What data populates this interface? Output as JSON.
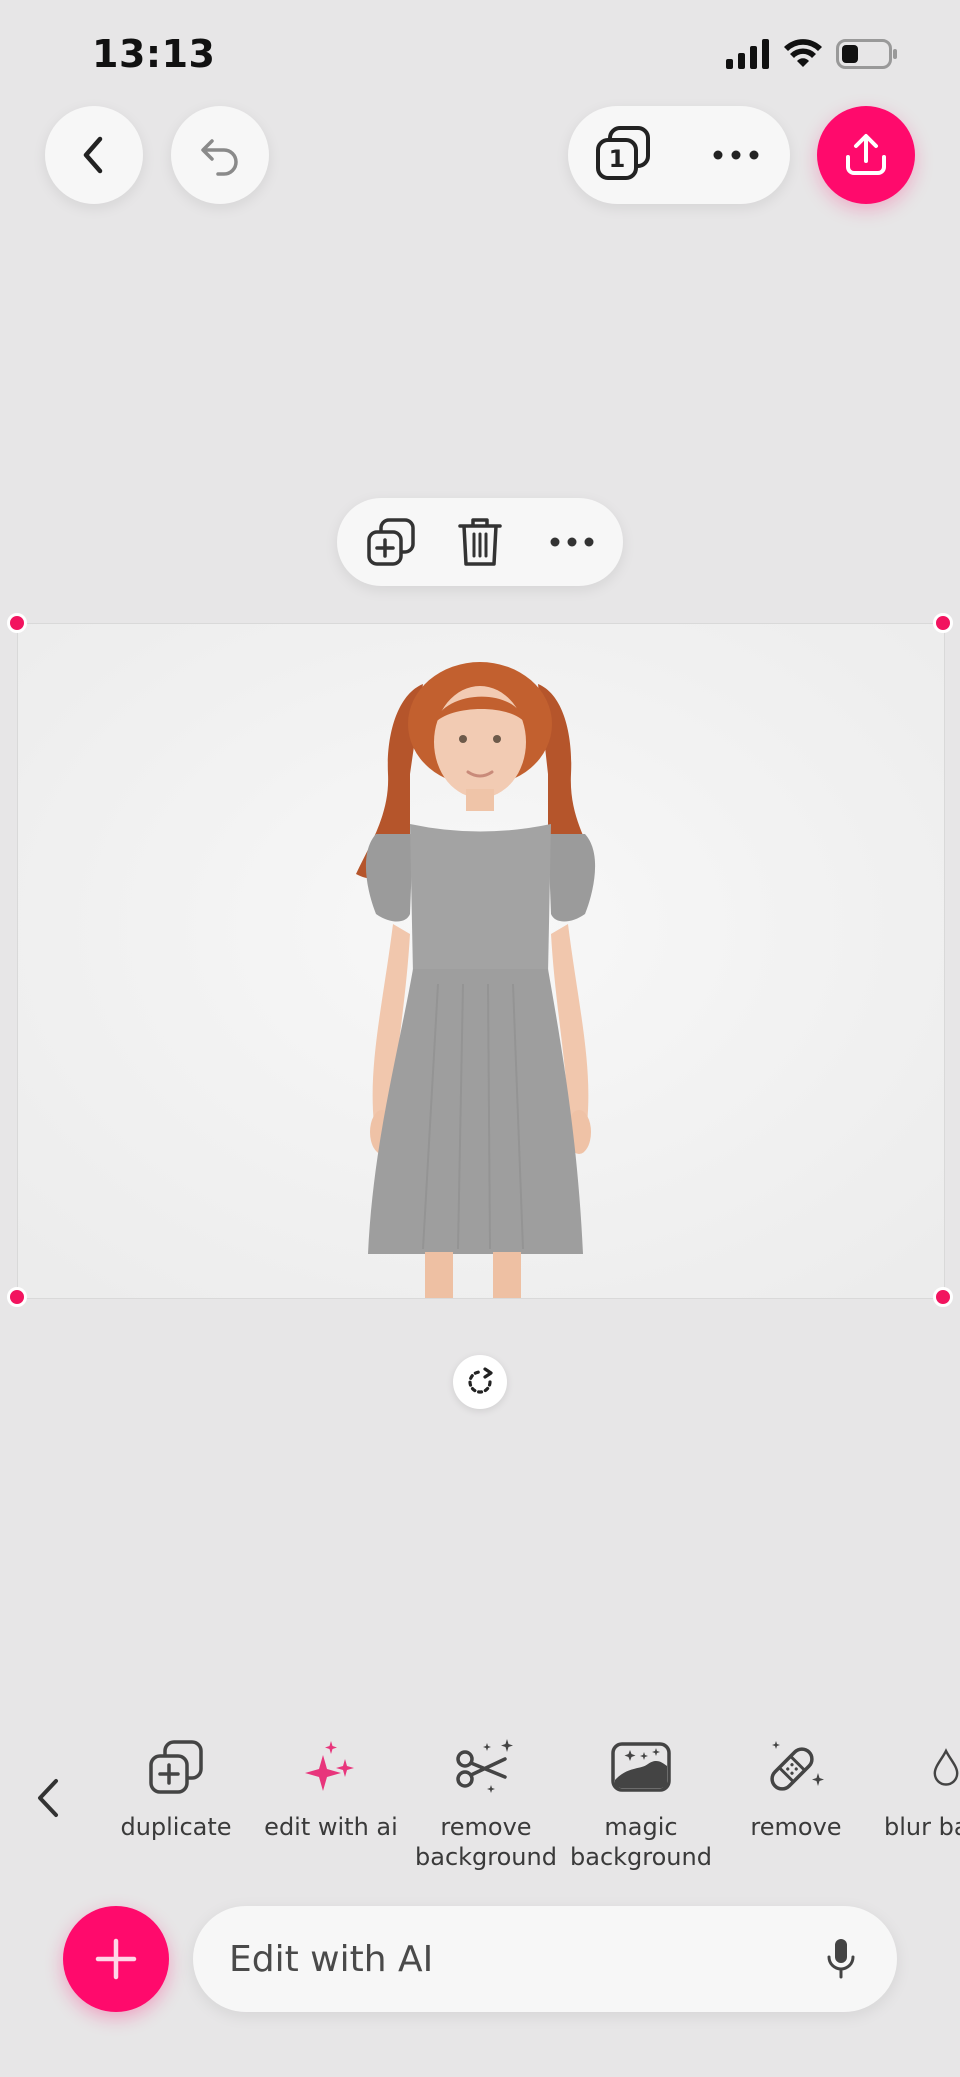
{
  "status_bar": {
    "time": "13:13",
    "icons": [
      "signal-icon",
      "wifi-icon",
      "battery-icon"
    ]
  },
  "top_bar": {
    "back_icon": "chevron-left-icon",
    "undo_icon": "undo-icon",
    "pages_count": "1",
    "more_icon": "ellipsis-icon",
    "share_icon": "share-upload-icon",
    "accent_color": "#ff0a6c"
  },
  "selection_menu": {
    "icons": [
      "duplicate-icon",
      "trash-icon",
      "ellipsis-icon"
    ]
  },
  "canvas": {
    "image_description_icon": "photo-girl-grey-dress",
    "rotate_icon": "rotate-icon"
  },
  "tools": {
    "collapse_icon": "chevron-left-icon",
    "items": [
      {
        "label": "duplicate",
        "icon": "duplicate-icon"
      },
      {
        "label": "edit with ai",
        "icon": "sparkles-icon"
      },
      {
        "label": "remove background",
        "icon": "scissors-sparkle-icon"
      },
      {
        "label": "magic background",
        "icon": "magic-background-icon"
      },
      {
        "label": "remove",
        "icon": "bandage-sparkle-icon"
      },
      {
        "label": "blur background",
        "icon": "drop-icon"
      }
    ]
  },
  "bottom": {
    "add_icon": "plus-icon",
    "ai_placeholder": "Edit with AI",
    "mic_icon": "microphone-icon"
  }
}
